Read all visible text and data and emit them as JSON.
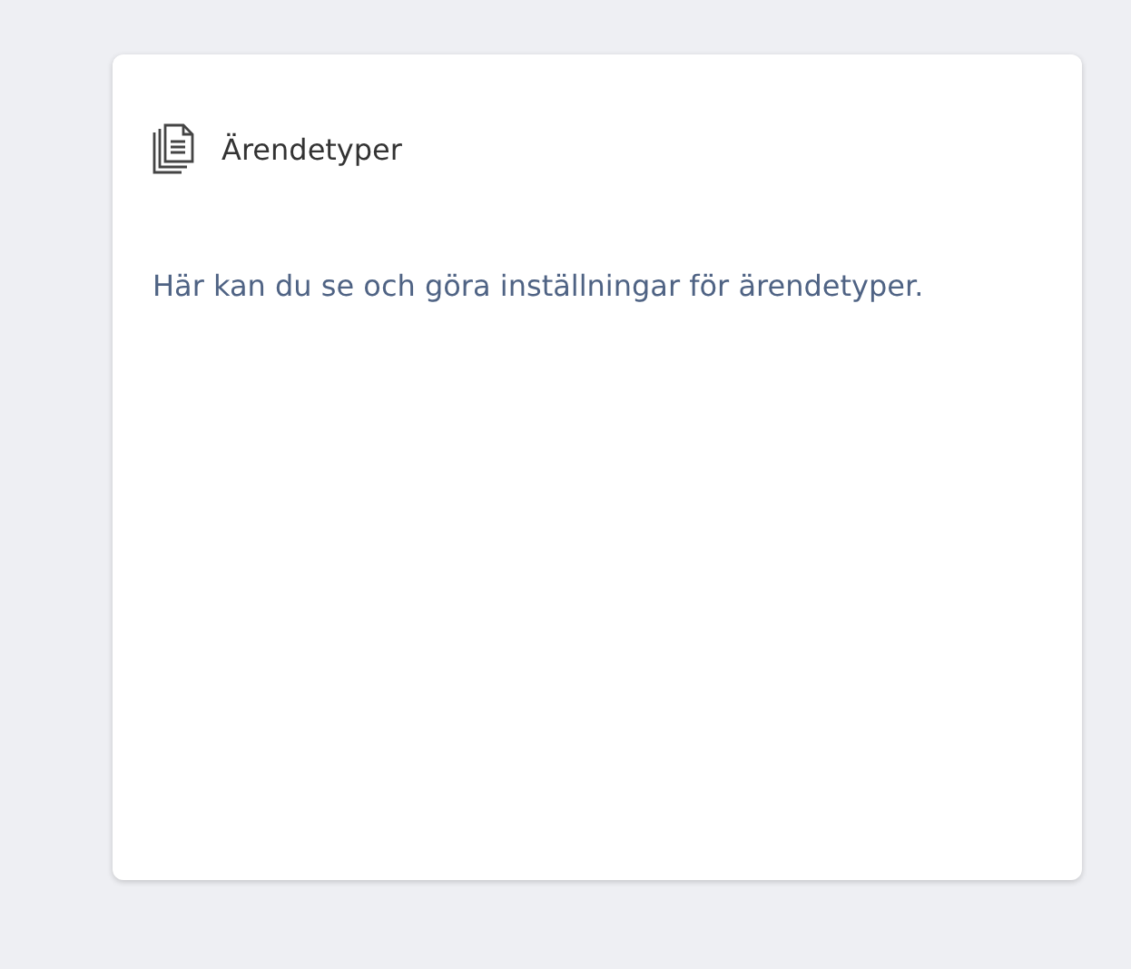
{
  "card": {
    "title": "Ärendetyper",
    "description": "Här kan du se och göra inställningar för ärendetyper."
  }
}
